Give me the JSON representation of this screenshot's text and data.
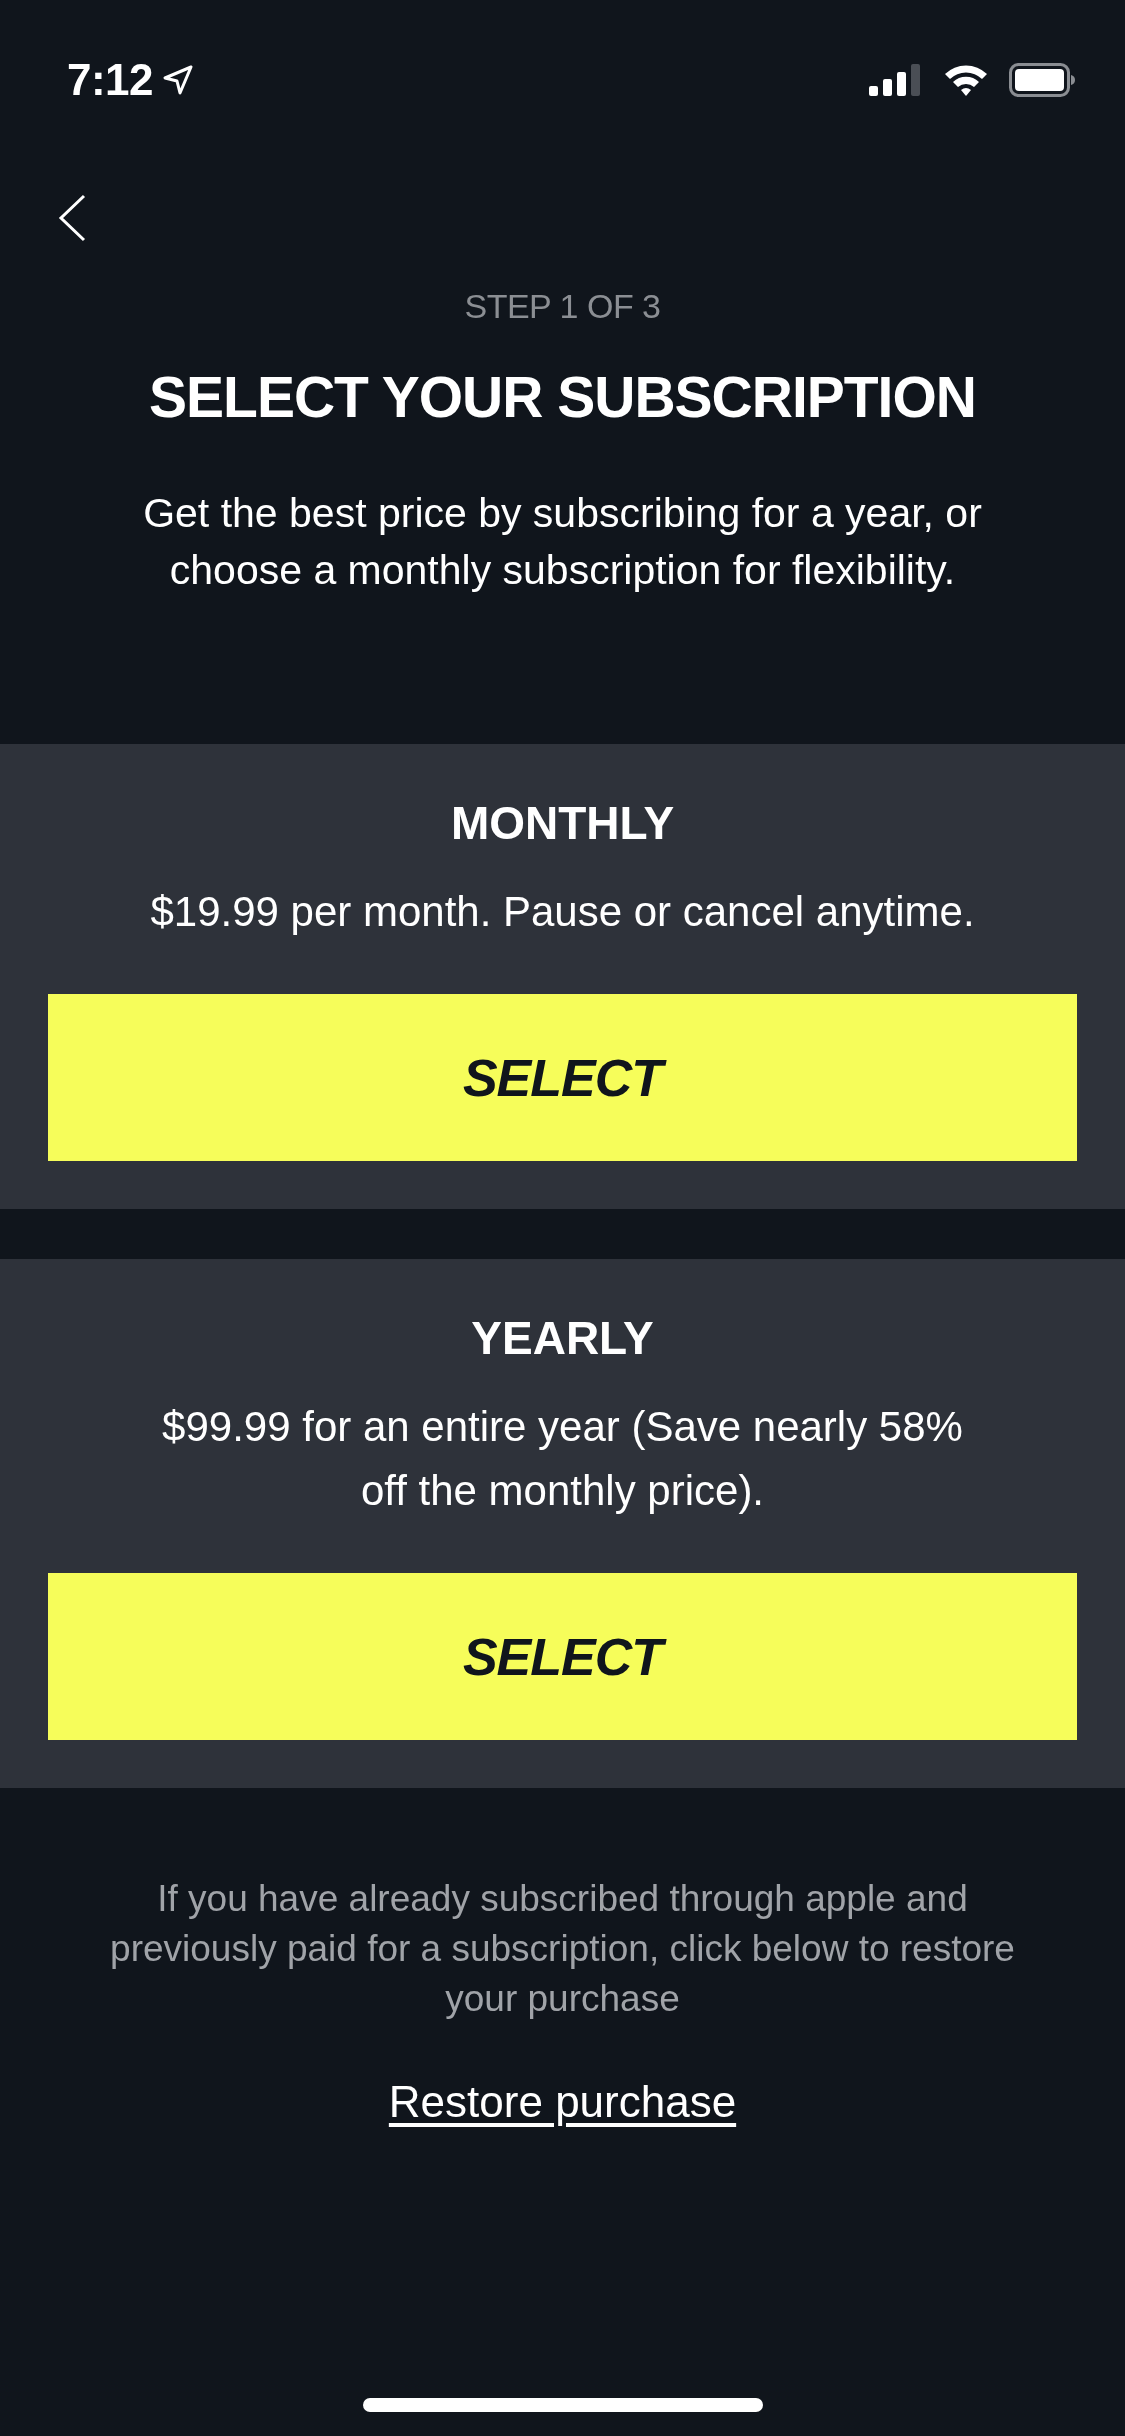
{
  "status_bar": {
    "time": "7:12"
  },
  "header": {
    "step": "STEP 1 OF 3",
    "title": "SELECT YOUR SUBSCRIPTION",
    "subtitle": "Get the best price by subscribing for a year, or choose a monthly subscription for flexibility."
  },
  "plans": [
    {
      "name": "MONTHLY",
      "description": "$19.99 per month. Pause or cancel anytime.",
      "button": "SELECT"
    },
    {
      "name": "YEARLY",
      "description": "$99.99 for an entire year (Save nearly 58% off the monthly price).",
      "button": "SELECT"
    }
  ],
  "footer": {
    "note": "If you have already subscribed through apple and previously paid for a subscription, click below to restore your purchase",
    "link": "Restore purchase"
  }
}
